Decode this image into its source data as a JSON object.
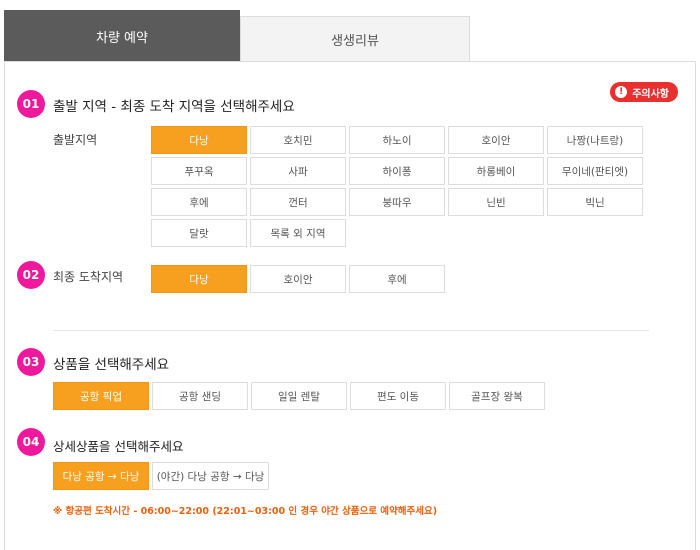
{
  "tabs": {
    "active": "차량 예약",
    "inactive": "생생리뷰"
  },
  "notice": {
    "label": "주의사항",
    "icon": "!"
  },
  "step1": {
    "num": "01",
    "title": "출발 지역 - 최종 도착 지역을 선택해주세요",
    "label": "출발지역",
    "options": [
      "다낭",
      "호치민",
      "하노이",
      "호이안",
      "나짱(나트랑)",
      "푸꾸옥",
      "사파",
      "하이퐁",
      "하롱베이",
      "무이네(판티엣)",
      "후에",
      "껀터",
      "붕따우",
      "닌빈",
      "빅닌",
      "달랏",
      "목록 외 지역"
    ],
    "selected": "다낭"
  },
  "step2": {
    "num": "02",
    "label": "최종 도착지역",
    "options": [
      "다낭",
      "호이안",
      "후에"
    ],
    "selected": "다낭"
  },
  "step3": {
    "num": "03",
    "title": "상품을 선택해주세요",
    "options": [
      "공항 픽업",
      "공항 샌딩",
      "일일 렌탈",
      "편도 이동",
      "골프장 왕복"
    ],
    "selected": "공항 픽업"
  },
  "step4": {
    "num": "04",
    "title": "상세상품을 선택해주세요",
    "options": [
      "다낭 공항 → 다낭",
      "(야간) 다낭 공항 → 다낭"
    ],
    "selected": "다낭 공항 → 다낭",
    "note": "※ 항공편 도착시간 - 06:00~22:00 (22:01~03:00 인 경우 야간 상품으로 예약해주세요)"
  }
}
